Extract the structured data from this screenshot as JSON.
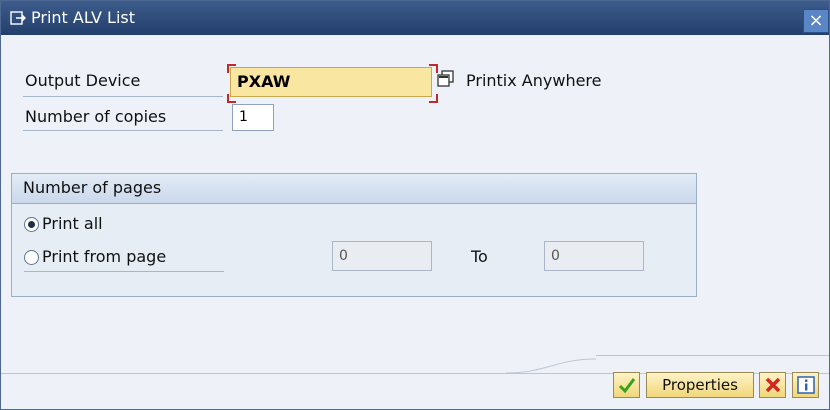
{
  "window": {
    "title": "Print ALV List"
  },
  "form": {
    "output_device": {
      "label": "Output Device",
      "value": "PXAW",
      "description": "Printix Anywhere"
    },
    "copies": {
      "label": "Number of copies",
      "value": "1"
    }
  },
  "pages": {
    "header": "Number of pages",
    "print_all_label": "Print all",
    "print_from_label": "Print from page",
    "from_value": "0",
    "to_label": "To",
    "to_value": "0",
    "selected": "print_all"
  },
  "buttons": {
    "properties_label": "Properties"
  },
  "colors": {
    "titlebar": "#2f4d7c",
    "required_field": "#f9e6a0",
    "button": "#f4dd8a",
    "ok": "#3aa11a",
    "cancel": "#d3261f",
    "info": "#2b63b5"
  },
  "icons": [
    "print-dialog-icon",
    "close-icon",
    "possible-entries-icon",
    "checkmark-icon",
    "cancel-x-icon",
    "info-icon"
  ]
}
